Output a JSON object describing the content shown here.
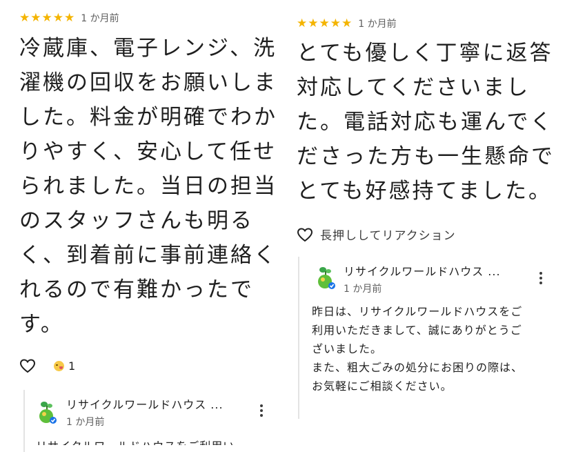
{
  "left_review": {
    "rating": 5,
    "age": "1 か月前",
    "body_lines": [
      "冷蔵庫、電子レンジ、洗",
      "濯機の回収をお願いしま",
      "した。料金が明確でわか",
      "りやすく、安心して任せ",
      "られました。当日の担当",
      "のスタッフさんも明る",
      "く、到着前に事前連絡く",
      "れるので有難かったで",
      "す。"
    ],
    "reaction_count": "1",
    "reply": {
      "name": "リサイクルワールドハウス ...",
      "age": "1 か月前",
      "text_preview": "リサイクルワールドハウスをご利用い"
    }
  },
  "right_review": {
    "rating": 5,
    "age": "1 か月前",
    "body_lines": [
      "とても優しく丁寧に返答",
      "対応してくださいまし",
      "た。電話対応も運んでく",
      "ださった方も一生懸命で",
      "とても好感持てました。"
    ],
    "reaction_prompt": "長押ししてリアクション",
    "reply": {
      "name": "リサイクルワールドハウス ...",
      "age": "1 か月前",
      "text_lines": [
        "昨日は、リサイクルワールドハウスをご",
        "利用いただきまして、誠にありがとうご",
        "ざいました。",
        "また、粗大ごみの処分にお困りの際は、",
        "お気軽にご相談ください。"
      ]
    }
  },
  "colors": {
    "star": "#f4b400",
    "text": "#1f1f1f",
    "muted": "#5f5f5f",
    "divider": "#e3e3e3",
    "verified": "#1a73e8"
  }
}
